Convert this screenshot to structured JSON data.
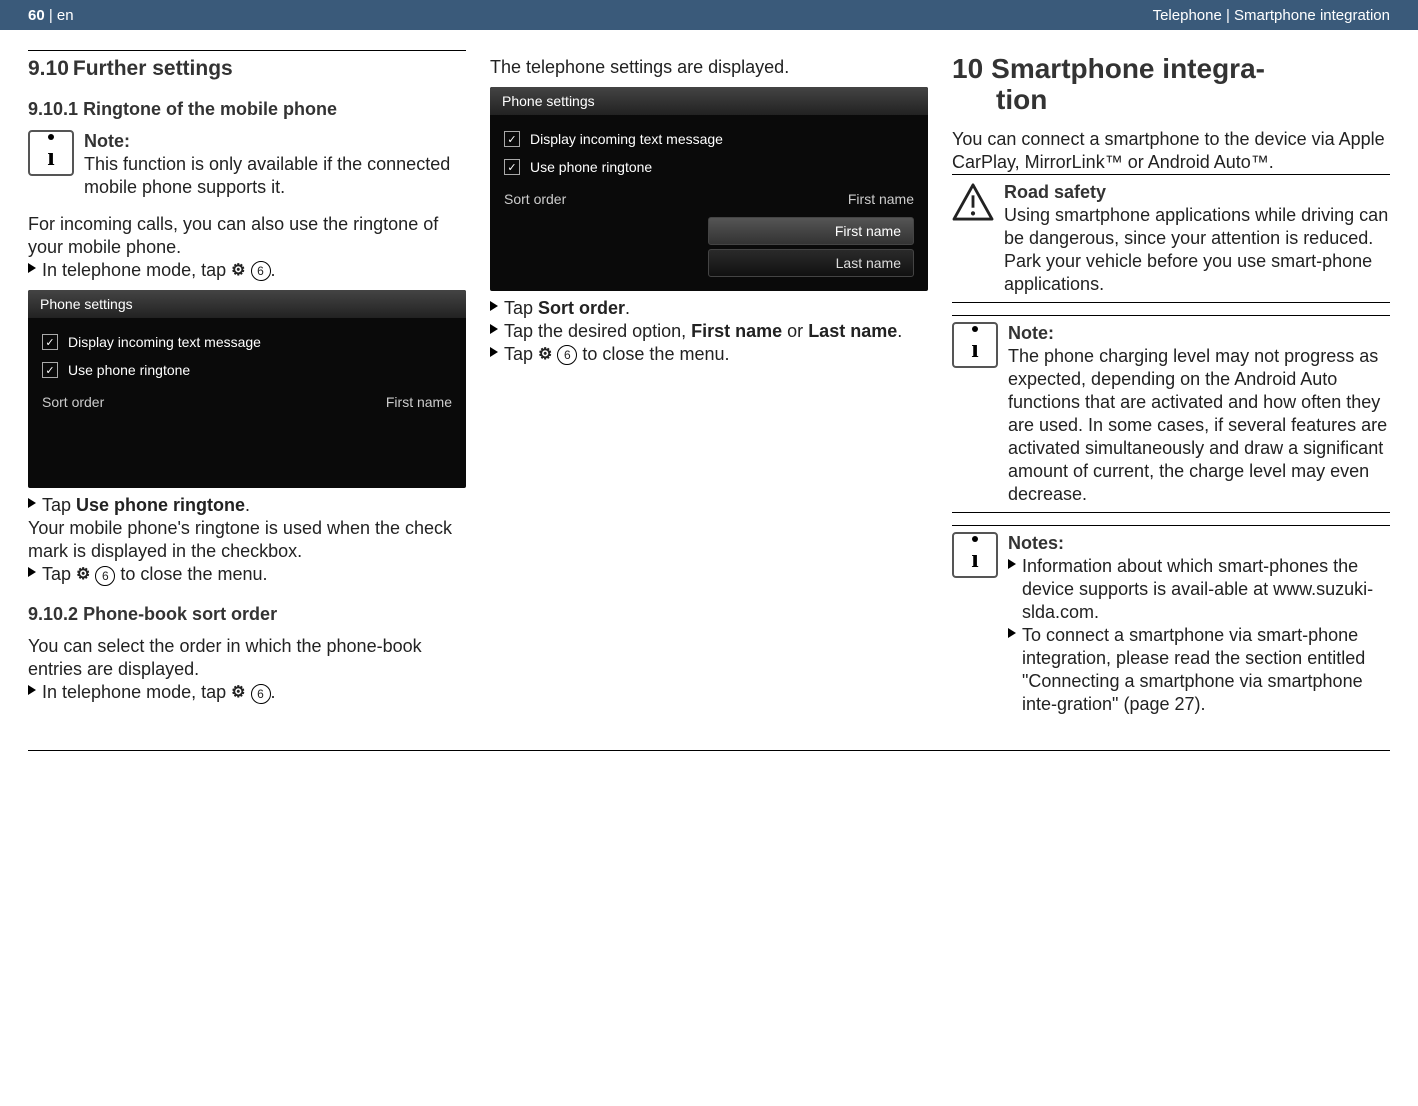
{
  "header": {
    "page_num": "60",
    "lang_sep": " | en",
    "right_text": "Telephone | Smartphone integration"
  },
  "col1": {
    "h_9_10_num": "9.10",
    "h_9_10_title": "Further settings",
    "h_9_10_1_num": "9.10.1",
    "h_9_10_1_title": "Ringtone of the mobile phone",
    "note1_title": "Note:",
    "note1_text": "This function is only available if the connected mobile phone supports it.",
    "para1": "For incoming calls, you can also use the ringtone of your mobile phone.",
    "step1_a": "In telephone mode, tap ",
    "gear": "⚙",
    "circ6": "6",
    "step1_b": ".",
    "ss1": {
      "title": "Phone settings",
      "chk1": "Display incoming text message",
      "chk2": "Use phone ringtone",
      "sort_label": "Sort order",
      "sort_value": "First name"
    },
    "step2_a": "Tap ",
    "step2_bold": "Use phone ringtone",
    "step2_b": ".",
    "para2": "Your mobile phone's ringtone is used when the check mark is displayed in the checkbox.",
    "step3_a": "Tap ",
    "step3_b": " to close the menu.",
    "h_9_10_2_num": "9.10.2",
    "h_9_10_2_title": "Phone-book sort order",
    "para3": "You can select the order in which the phone-book entries are displayed.",
    "step4_a": "In telephone mode, tap ",
    "step4_b": "."
  },
  "col2": {
    "para1": "The telephone settings are displayed.",
    "ss2": {
      "title": "Phone settings",
      "chk1": "Display incoming text message",
      "chk2": "Use phone ringtone",
      "sort_label": "Sort order",
      "sort_value": "First name",
      "opt1": "First name",
      "opt2": "Last name"
    },
    "step1_a": "Tap ",
    "step1_bold": "Sort order",
    "step1_b": ".",
    "step2_a": "Tap the desired option, ",
    "step2_bold1": "First name",
    "step2_mid": " or ",
    "step2_bold2": "Last name",
    "step2_b": ".",
    "step3_a": "Tap ",
    "step3_b": " to close the menu."
  },
  "col3": {
    "chapter_num": "10",
    "chapter_title_l1": "Smartphone integra-",
    "chapter_title_l2": "tion",
    "para1": "You can connect a smartphone to the device via Apple CarPlay, MirrorLink™ or Android Auto™.",
    "warn_title": "Road safety",
    "warn_text1": "Using smartphone applications while driving can be dangerous, since your attention is reduced.",
    "warn_text2": "Park your vehicle before you use smart-phone applications.",
    "note2_title": "Note:",
    "note2_text": "The phone charging level may not progress as expected, depending on the Android Auto functions that are activated and how often they are used. In some cases, if several features are activated simultaneously and draw a significant amount of current, the charge level may even decrease.",
    "notes_title": "Notes:",
    "notes_item1": "Information about which smart-phones the device supports is avail-able at www.suzuki-slda.com.",
    "notes_item2": "To connect a smartphone via smart-phone integration, please read the section entitled \"Connecting a smartphone via smartphone inte-gration\" (page 27)."
  }
}
